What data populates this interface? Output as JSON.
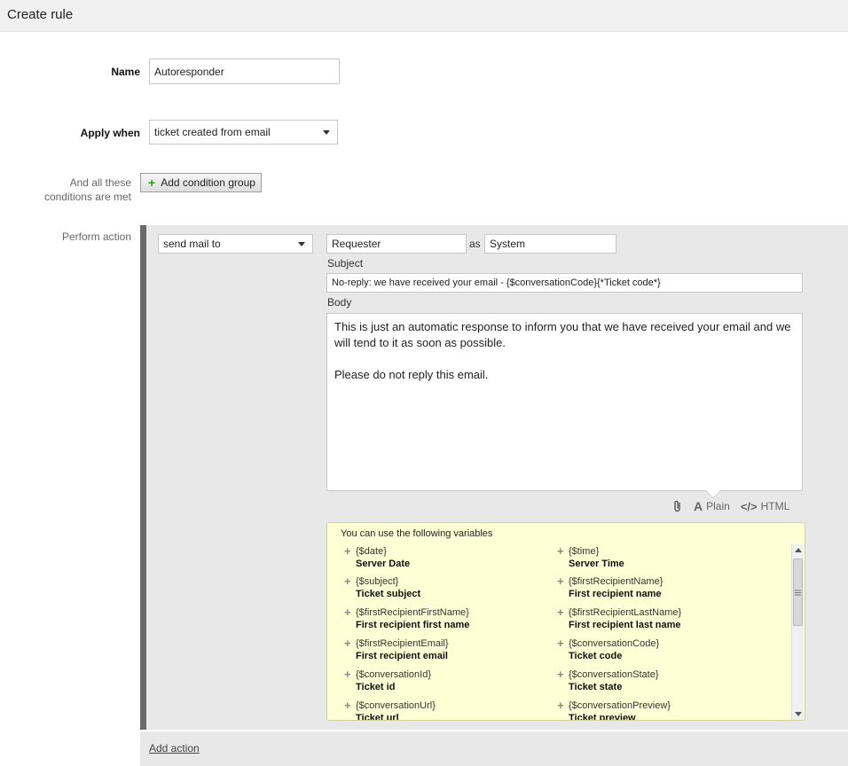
{
  "header": {
    "title": "Create rule"
  },
  "form": {
    "name_label": "Name",
    "name_value": "Autoresponder",
    "apply_when_label": "Apply when",
    "apply_when_value": "ticket created from email",
    "conditions_label_line1": "And all these",
    "conditions_label_line2": "conditions are met",
    "add_condition_group_label": "Add condition group",
    "perform_action_label": "Perform action"
  },
  "action": {
    "type_value": "send mail to",
    "recipient_value": "Requester",
    "as_label": "as",
    "sender_value": "System",
    "subject_label": "Subject",
    "subject_value": "No-reply: we have received your email - {$conversationCode}{*Ticket code*}",
    "body_label": "Body",
    "body_value": "This is just an automatic response to inform you that we have received your email and we will tend to it as soon as possible.\n\nPlease do not reply this email.",
    "format_plain_label": "Plain",
    "format_html_label": "HTML",
    "format_plain_glyph": "A",
    "format_html_glyph": "</>"
  },
  "variables": {
    "title": "You can use the following variables",
    "items": [
      {
        "code": "{$date}",
        "desc": "Server Date"
      },
      {
        "code": "{$time}",
        "desc": "Server Time"
      },
      {
        "code": "{$subject}",
        "desc": "Ticket subject"
      },
      {
        "code": "{$firstRecipientName}",
        "desc": "First recipient name"
      },
      {
        "code": "{$firstRecipientFirstName}",
        "desc": "First recipient first name"
      },
      {
        "code": "{$firstRecipientLastName}",
        "desc": "First recipient last name"
      },
      {
        "code": "{$firstRecipientEmail}",
        "desc": "First recipient email"
      },
      {
        "code": "{$conversationCode}",
        "desc": "Ticket code"
      },
      {
        "code": "{$conversationId}",
        "desc": "Ticket id"
      },
      {
        "code": "{$conversationState}",
        "desc": "Ticket state"
      },
      {
        "code": "{$conversationUrl}",
        "desc": "Ticket url"
      },
      {
        "code": "{$conversationPreview}",
        "desc": "Ticket preview"
      }
    ]
  },
  "footer": {
    "add_action_label": "Add action"
  }
}
